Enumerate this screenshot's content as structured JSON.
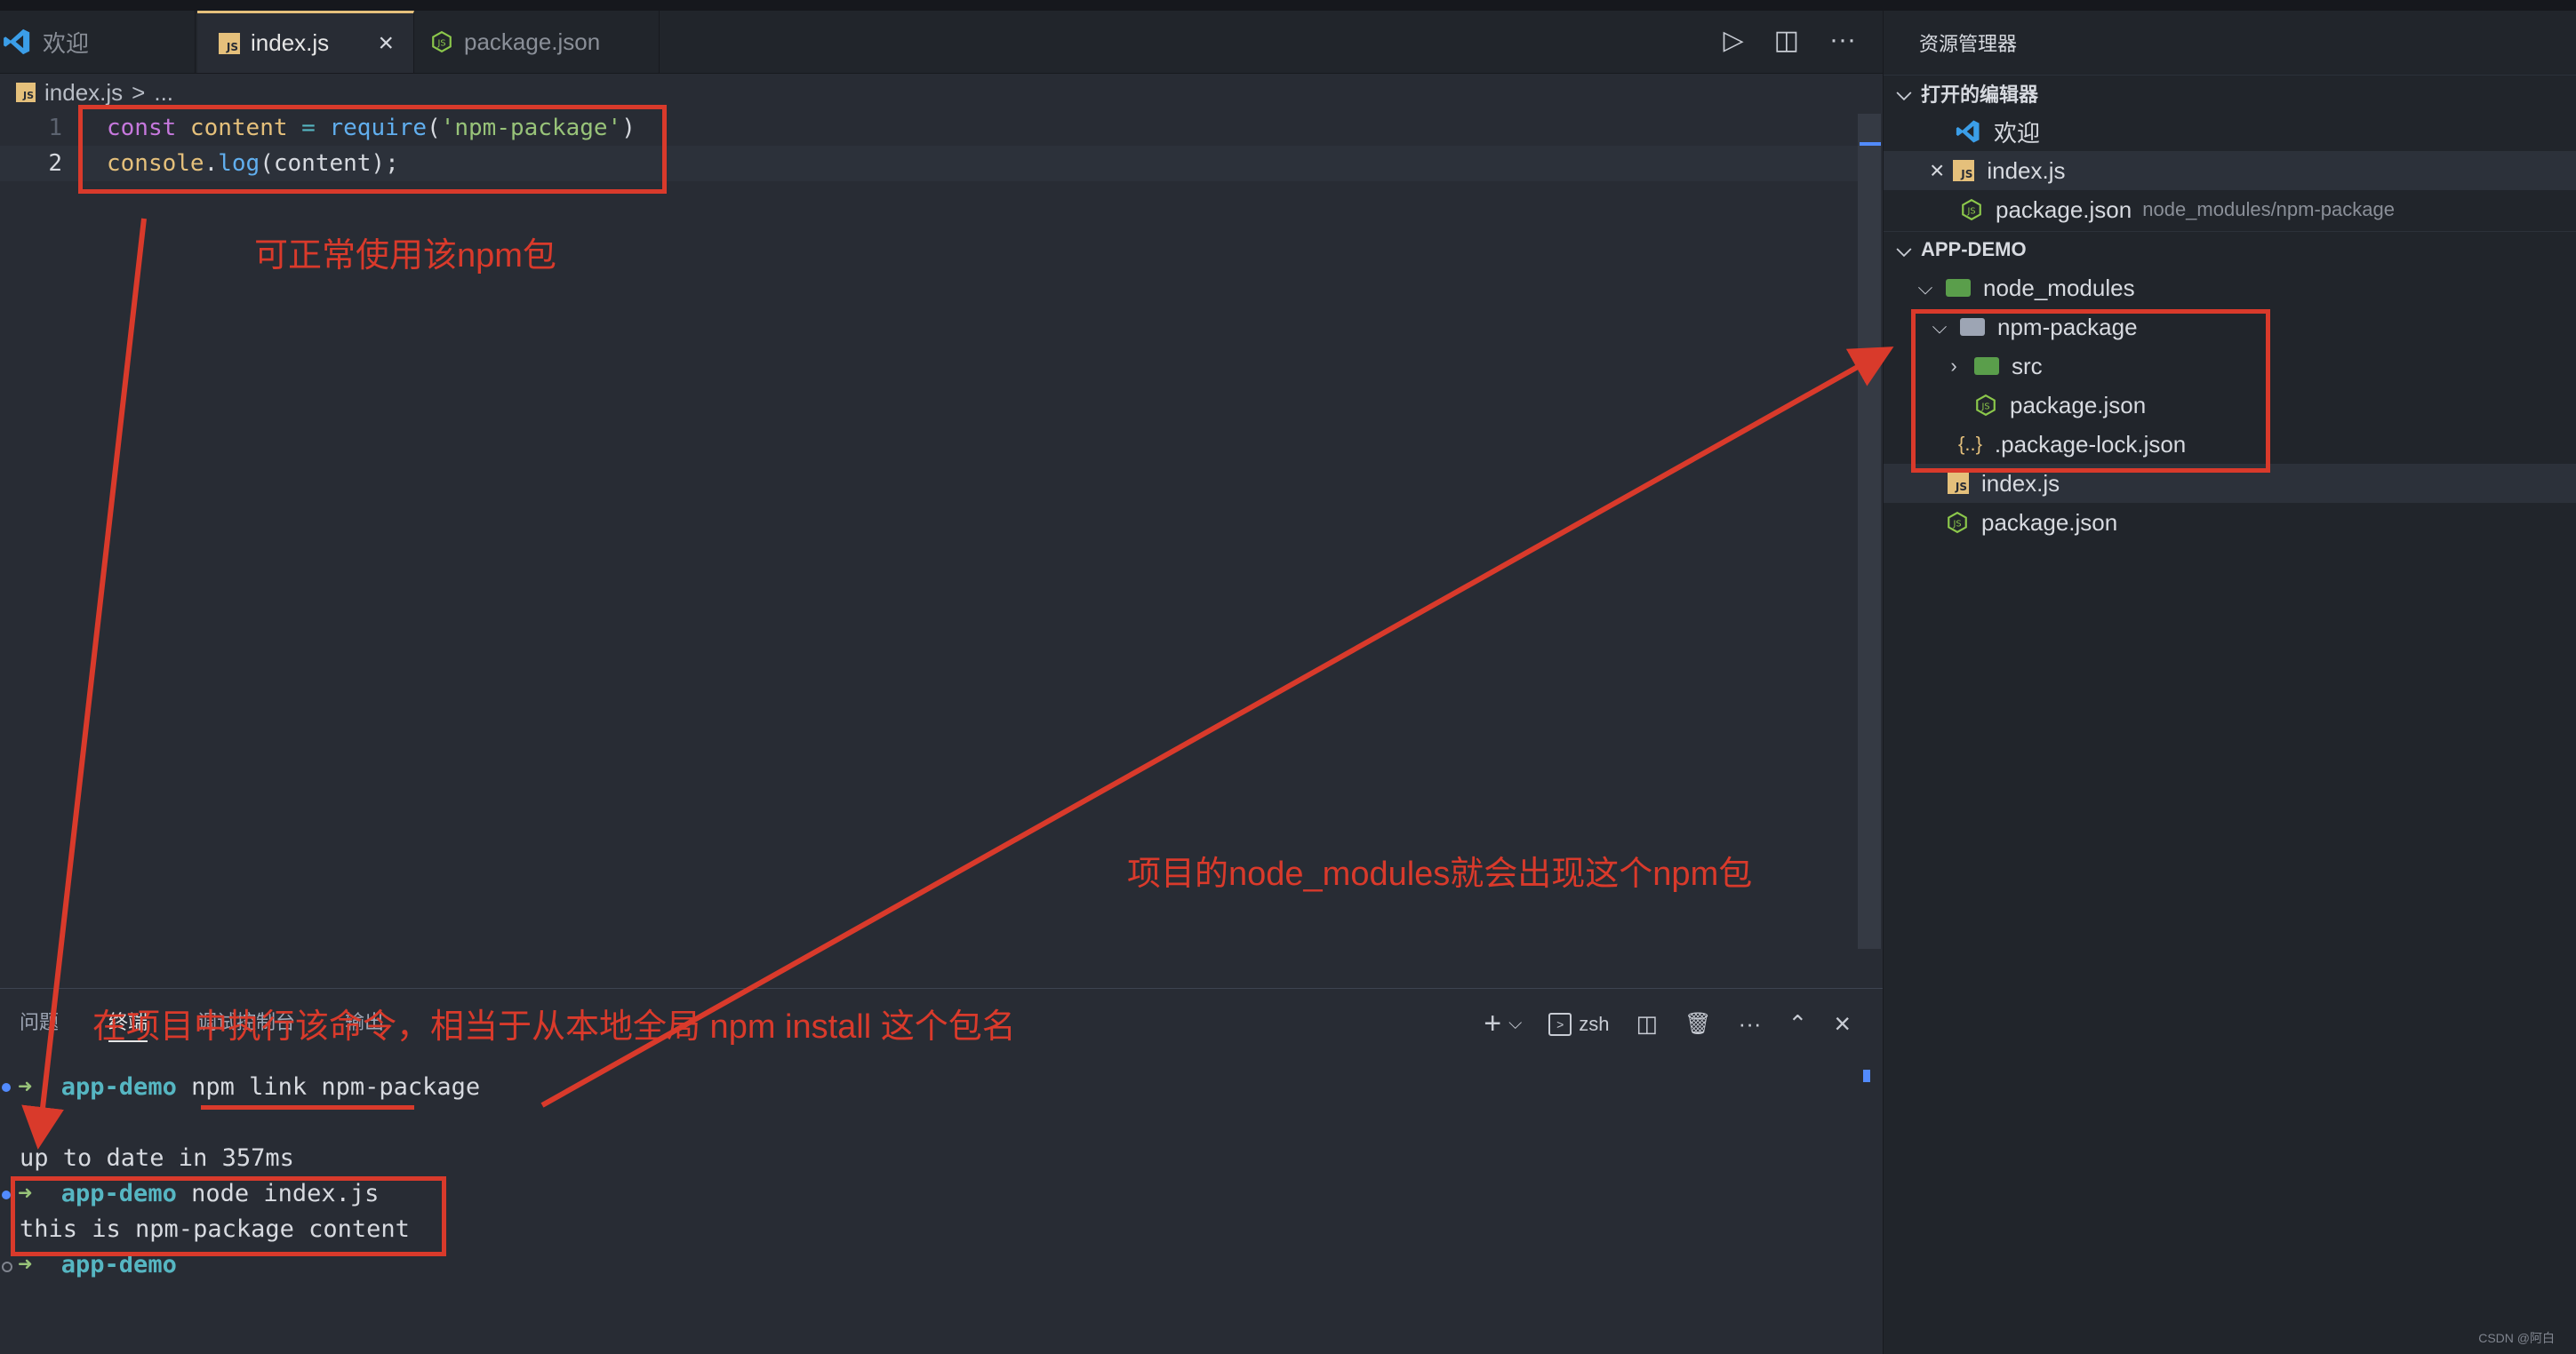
{
  "tabs": [
    {
      "label": "欢迎",
      "icon": "vscode-icon"
    },
    {
      "label": "index.js",
      "icon": "js-file-icon",
      "active": true,
      "close": "×"
    },
    {
      "label": "package.json",
      "icon": "nodejs-icon"
    }
  ],
  "tab_actions": {
    "run": "▷",
    "split": "◫",
    "more": "···"
  },
  "breadcrumb": {
    "file": "index.js",
    "sep": ">",
    "rest": "..."
  },
  "editor": {
    "lines": [
      {
        "num": "1",
        "tokens": [
          "const",
          " content ",
          "=",
          " require",
          "(",
          "'npm-package'",
          ")"
        ]
      },
      {
        "num": "2",
        "tokens": [
          "console",
          ".",
          "log",
          "(content);"
        ]
      }
    ]
  },
  "panel": {
    "tabs": [
      "问题",
      "终端",
      "调试控制台",
      "输出"
    ],
    "active_tab": "终端",
    "actions": {
      "add": "+",
      "dropdown": "⌵",
      "shell": "zsh",
      "split": "◫",
      "trash": "🗑",
      "more": "···",
      "maximize": "⌃",
      "close": "×"
    },
    "terminal": [
      {
        "arrow": "➜",
        "dir": "app-demo",
        "cmd": " npm link npm-package"
      },
      {
        "text": "up to date in 357ms"
      },
      {
        "arrow": "➜",
        "dir": "app-demo",
        "cmd": " node index.js"
      },
      {
        "text": "this is npm-package content"
      },
      {
        "arrow": "➜",
        "dir": "app-demo",
        "cmd": ""
      }
    ]
  },
  "sidebar": {
    "title": "资源管理器",
    "open_editors": {
      "label": "打开的编辑器",
      "items": [
        {
          "label": "欢迎",
          "icon": "vscode-icon"
        },
        {
          "label": "index.js",
          "icon": "js-file-icon",
          "close": "×"
        },
        {
          "label": "package.json",
          "desc": "node_modules/npm-package",
          "icon": "nodejs-icon"
        }
      ]
    },
    "project": {
      "label": "APP-DEMO",
      "items": [
        {
          "label": "node_modules",
          "icon": "folder-icon"
        },
        {
          "label": "npm-package",
          "icon": "folder-open-icon"
        },
        {
          "label": "src",
          "icon": "src-folder-icon"
        },
        {
          "label": "package.json",
          "icon": "nodejs-icon"
        },
        {
          "label": ".package-lock.json",
          "icon": "json-braces-icon"
        },
        {
          "label": "index.js",
          "icon": "js-file-icon"
        },
        {
          "label": "package.json",
          "icon": "nodejs-icon"
        }
      ]
    }
  },
  "annotations": {
    "editor_note": "可正常使用该npm包",
    "sidebar_note": "项目的node_modules就会出现这个npm包",
    "terminal_note": "在项目中执行该命令，相当于从本地全局 npm install 这个包名"
  },
  "watermark": "CSDN @阿白",
  "colors": {
    "annotation": "#d93a2b",
    "js_badge": "#e5c07b",
    "node_green": "#8cc84b",
    "folder_green": "#5a9e4b"
  }
}
